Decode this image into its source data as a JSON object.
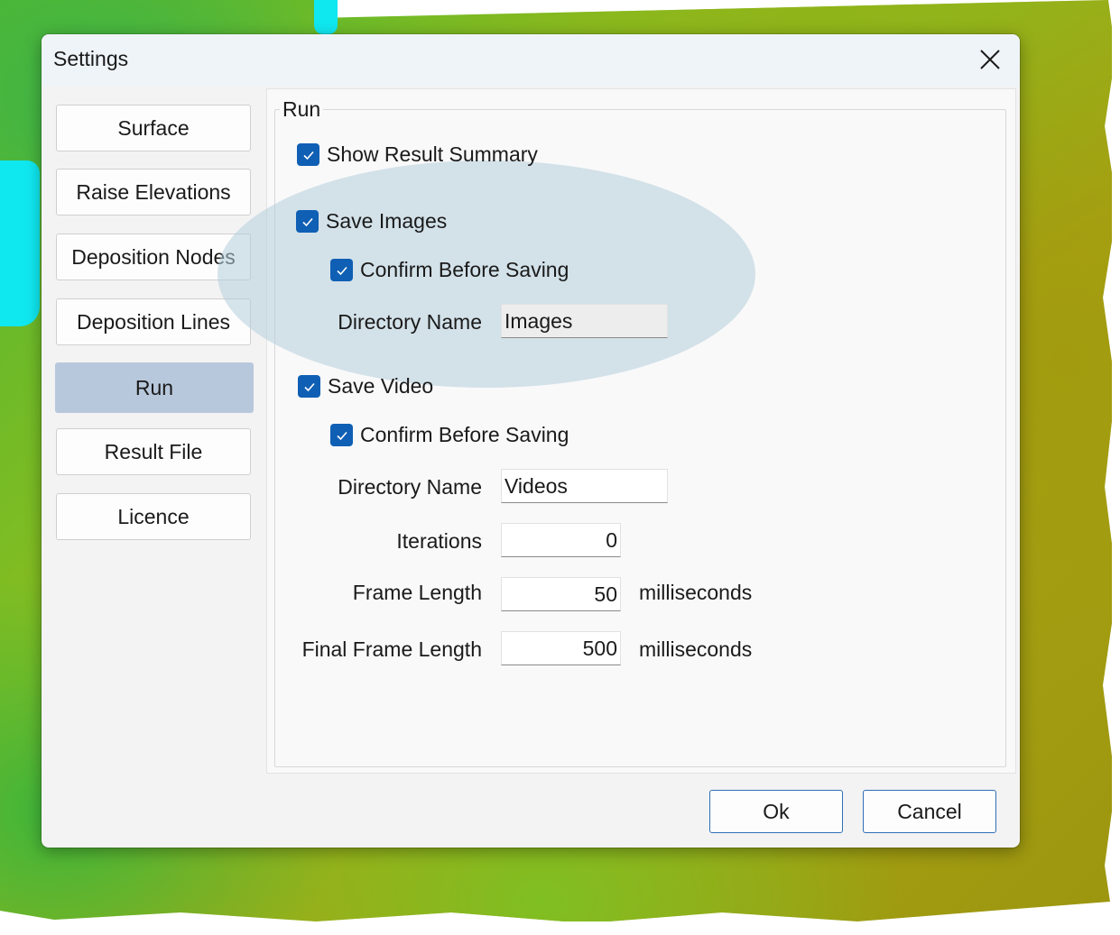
{
  "window": {
    "title": "Settings"
  },
  "nav": {
    "items": [
      {
        "label": "Surface"
      },
      {
        "label": "Raise Elevations"
      },
      {
        "label": "Deposition Nodes"
      },
      {
        "label": "Deposition Lines"
      },
      {
        "label": "Run",
        "selected": true
      },
      {
        "label": "Result File"
      },
      {
        "label": "Licence"
      }
    ]
  },
  "run": {
    "group_label": "Run",
    "show_result_summary": {
      "label": "Show Result Summary",
      "checked": true
    },
    "save_images": {
      "label": "Save Images",
      "checked": true,
      "confirm": {
        "label": "Confirm Before Saving",
        "checked": true
      },
      "directory": {
        "label": "Directory Name",
        "value": "Images"
      }
    },
    "save_video": {
      "label": "Save Video",
      "checked": true,
      "confirm": {
        "label": "Confirm Before Saving",
        "checked": true
      },
      "directory": {
        "label": "Directory Name",
        "value": "Videos"
      },
      "iterations": {
        "label": "Iterations",
        "value": "0"
      },
      "frame_length": {
        "label": "Frame Length",
        "value": "50",
        "unit": "milliseconds"
      },
      "final_frame_length": {
        "label": "Final Frame Length",
        "value": "500",
        "unit": "milliseconds"
      }
    }
  },
  "buttons": {
    "ok": "Ok",
    "cancel": "Cancel"
  },
  "icons": {
    "close": "close-icon",
    "check": "checkmark-icon"
  },
  "colors": {
    "accent": "#0f5fb4",
    "selected_nav": "#b8c8dc",
    "highlight": "#b4cddc"
  }
}
